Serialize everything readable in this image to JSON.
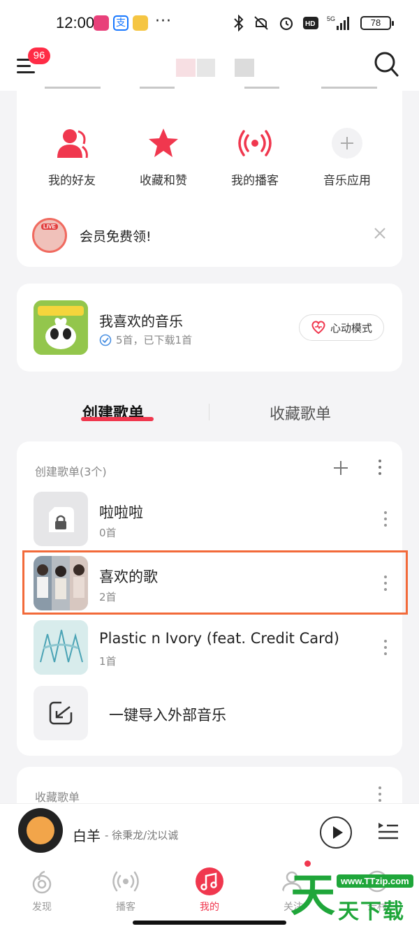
{
  "status_bar": {
    "time": "12:00",
    "dots": "···",
    "network": "5G",
    "battery": "78"
  },
  "header": {
    "notification_count": "96"
  },
  "quick_actions": [
    {
      "label": "我的好友",
      "icon": "friends-icon"
    },
    {
      "label": "收藏和赞",
      "icon": "star-icon"
    },
    {
      "label": "我的播客",
      "icon": "podcast-icon"
    },
    {
      "label": "音乐应用",
      "icon": "plus-icon"
    }
  ],
  "vip_banner": {
    "badge": "LIVE",
    "text": "会员免费领!"
  },
  "liked_music": {
    "title": "我喜欢的音乐",
    "subtitle": "5首，已下载1首",
    "mode_button": "心动模式"
  },
  "tabs": {
    "created": "创建歌单",
    "collected": "收藏歌单"
  },
  "created_section": {
    "header": "创建歌单(3个)",
    "playlists": [
      {
        "name": "啦啦啦",
        "count": "0首"
      },
      {
        "name": "喜欢的歌",
        "count": "2首"
      },
      {
        "name": "Plastic n Ivory (feat. Credit Card)",
        "count": "1首"
      }
    ],
    "import_label": "一键导入外部音乐"
  },
  "collected_section": {
    "header": "收藏歌单"
  },
  "mini_player": {
    "title": "白羊",
    "artist": "- 徐秉龙/沈以诚"
  },
  "bottom_nav": [
    {
      "label": "发现",
      "active": false
    },
    {
      "label": "播客",
      "active": false
    },
    {
      "label": "我的",
      "active": true
    },
    {
      "label": "关注",
      "active": false
    },
    {
      "label": "云村",
      "active": false
    }
  ],
  "watermark": {
    "big": "天",
    "url": "www.TTzip.com",
    "text": "天下载"
  },
  "colors": {
    "accent": "#f0374e",
    "highlight_box": "#f26a3a",
    "watermark": "#1fa63a"
  }
}
